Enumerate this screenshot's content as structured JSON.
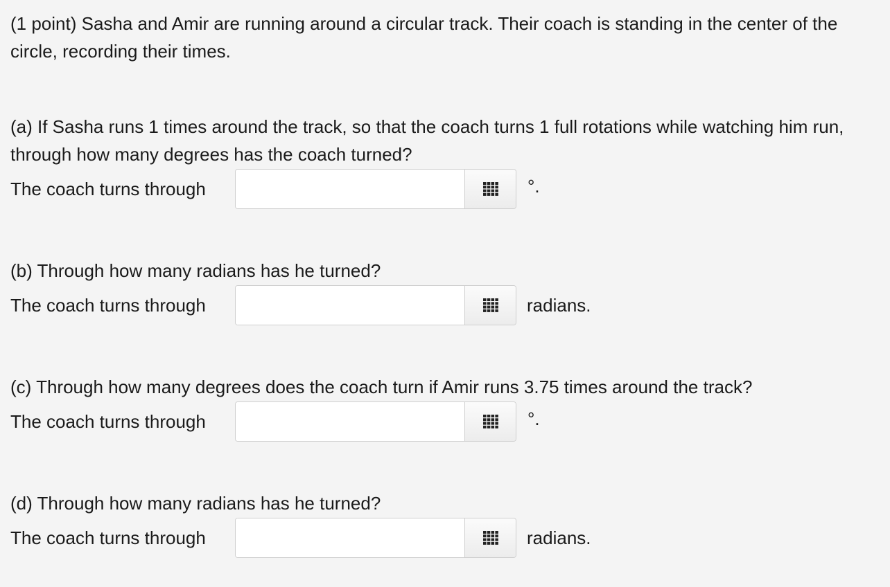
{
  "problem": {
    "intro": "(1 point) Sasha and Amir are running around a circular track. Their coach is standing in the center of the circle, recording their times."
  },
  "parts": [
    {
      "question": "(a) If Sasha runs 1 times around the track, so that the coach turns 1 full rotations while watching him run, through how many degrees has the coach turned?",
      "label": "The coach turns through",
      "value": "",
      "unit": "°."
    },
    {
      "question": "(b) Through how many radians has he turned?",
      "label": "The coach turns through",
      "value": "",
      "unit": "radians."
    },
    {
      "question": "(c) Through how many degrees does the coach turn if Amir runs 3.75 times around the track?",
      "label": "The coach turns through",
      "value": "",
      "unit": "°."
    },
    {
      "question": "(d) Through how many radians has he turned?",
      "label": "The coach turns through",
      "value": "",
      "unit": "radians."
    }
  ],
  "icons": {
    "equation_editor": "grid-icon"
  },
  "colors": {
    "background": "#f4f4f4",
    "input_border": "#cfcfcf",
    "icon": "#222222"
  }
}
